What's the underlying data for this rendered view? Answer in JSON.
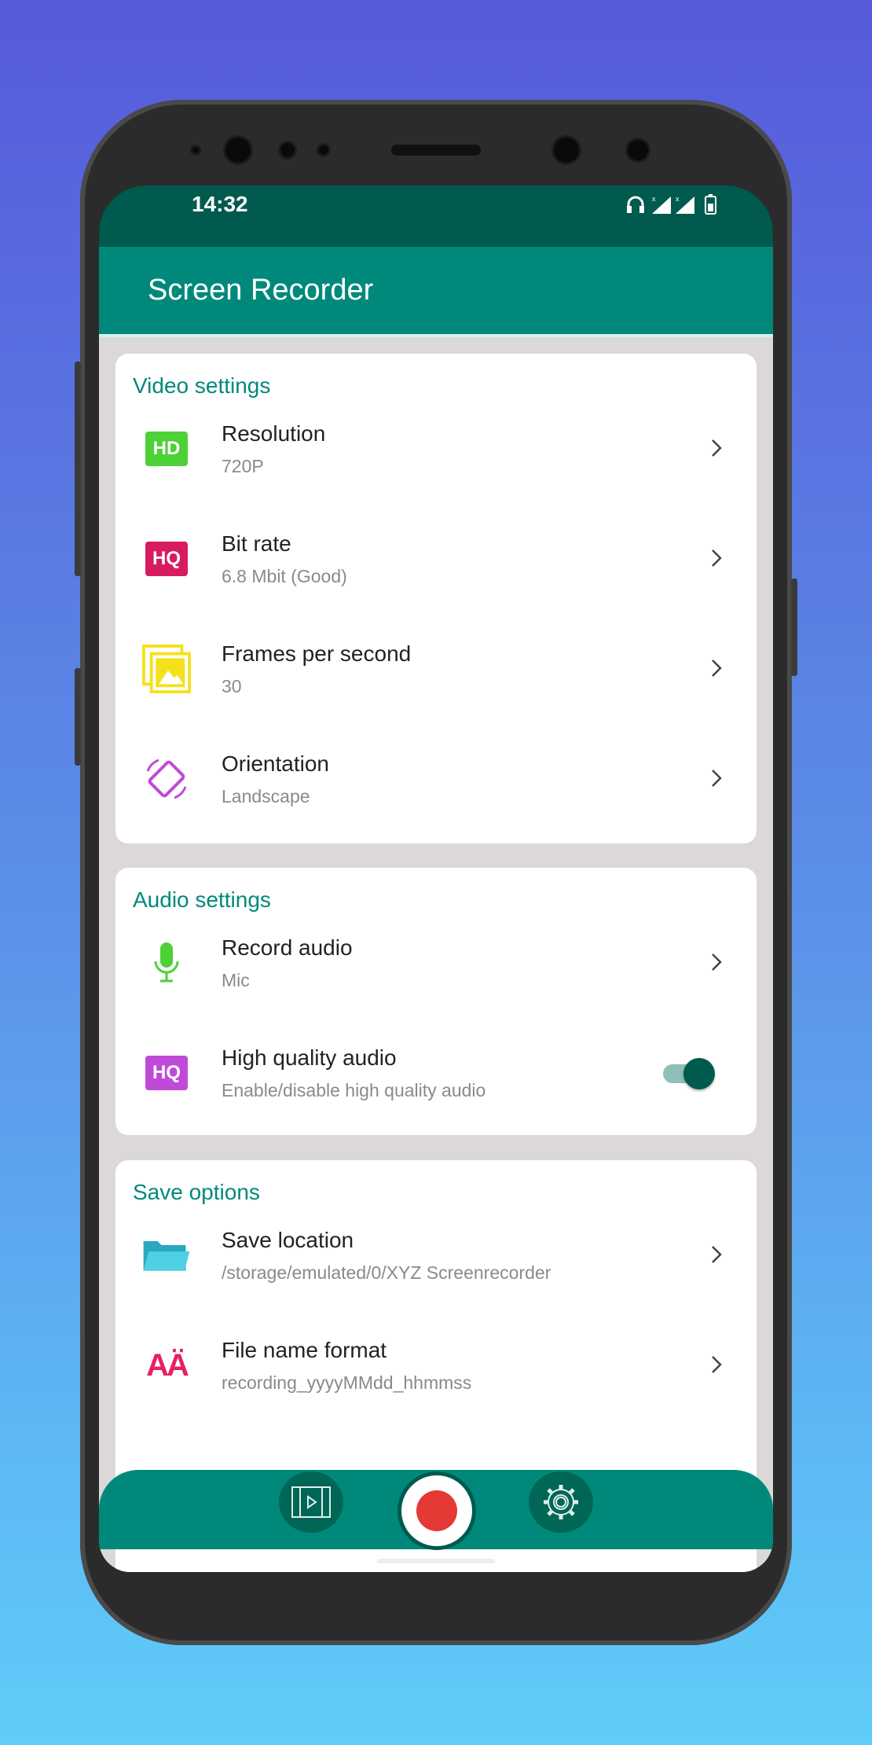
{
  "status_bar": {
    "time": "14:32",
    "icons": [
      "headphones-icon",
      "signal-icon",
      "signal-icon",
      "battery-icon"
    ]
  },
  "app_bar": {
    "title": "Screen Recorder"
  },
  "sections": [
    {
      "header": "Video settings",
      "items": [
        {
          "title": "Resolution",
          "subtitle": "720P",
          "icon": "hd-icon"
        },
        {
          "title": "Bit rate",
          "subtitle": "6.8 Mbit (Good)",
          "icon": "hq-icon"
        },
        {
          "title": "Frames per second",
          "subtitle": "30",
          "icon": "image-frames-icon"
        },
        {
          "title": "Orientation",
          "subtitle": "Landscape",
          "icon": "rotate-screen-icon"
        }
      ]
    },
    {
      "header": "Audio settings",
      "items": [
        {
          "title": "Record audio",
          "subtitle": "Mic",
          "icon": "microphone-icon"
        },
        {
          "title": "High quality audio",
          "subtitle": "Enable/disable high quality audio",
          "icon": "hq-icon",
          "toggle": true
        }
      ]
    },
    {
      "header": "Save options",
      "items": [
        {
          "title": "Save location",
          "subtitle": "/storage/emulated/0/XYZ Screenrecorder",
          "icon": "folder-icon"
        },
        {
          "title": "File name format",
          "subtitle": "recording_yyyyMMdd_hhmmss",
          "icon": "font-icon"
        }
      ]
    }
  ],
  "icon_labels": {
    "hd": "HD",
    "hq": "HQ",
    "font": "AÄ"
  },
  "colors": {
    "primary": "#00897b",
    "primary_dark": "#005a4e",
    "record": "#e53935"
  }
}
